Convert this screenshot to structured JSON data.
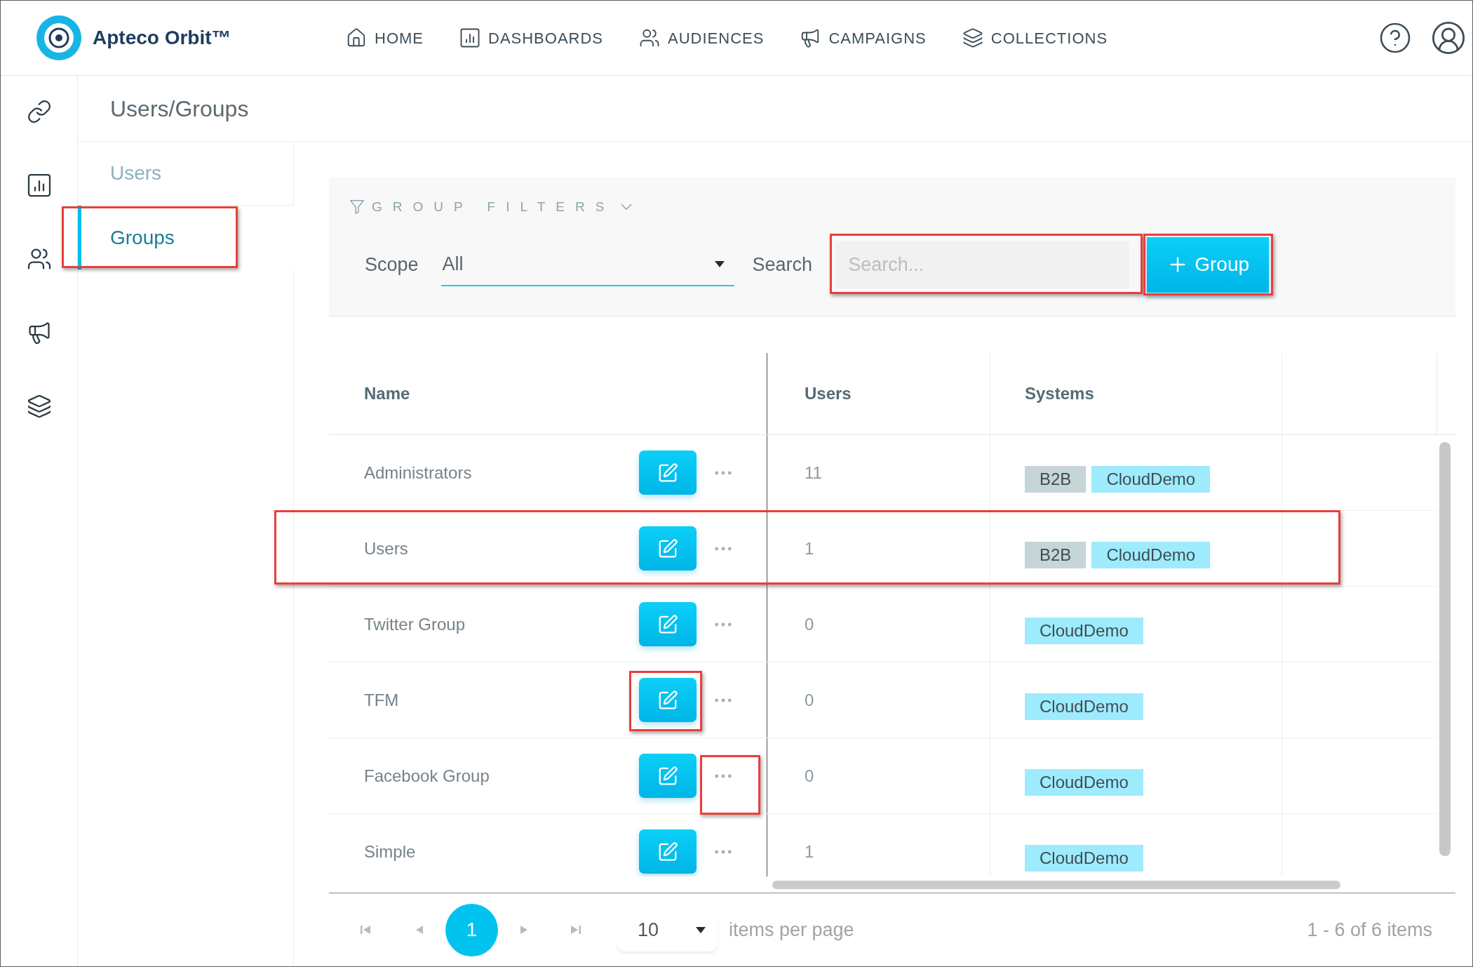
{
  "header": {
    "brand": "Apteco Orbit™",
    "nav": [
      {
        "label": "HOME"
      },
      {
        "label": "DASHBOARDS"
      },
      {
        "label": "AUDIENCES"
      },
      {
        "label": "CAMPAIGNS"
      },
      {
        "label": "COLLECTIONS"
      }
    ]
  },
  "page_title": "Users/Groups",
  "submenu": {
    "items": [
      {
        "label": "Users",
        "selected": false,
        "highlighted": false
      },
      {
        "label": "Groups",
        "selected": true,
        "highlighted": true
      }
    ]
  },
  "filters": {
    "title": "GROUP FILTERS",
    "scope": {
      "label": "Scope",
      "value": "All"
    },
    "search": {
      "label": "Search",
      "placeholder": "Search...",
      "highlighted": true
    },
    "add_button": {
      "label": "Group",
      "highlighted": true
    }
  },
  "table": {
    "columns": [
      "Name",
      "Users",
      "Systems"
    ],
    "rows": [
      {
        "name": "Administrators",
        "users": "11",
        "systems": [
          {
            "label": "B2B",
            "color": "#c5d5d8"
          },
          {
            "label": "CloudDemo",
            "color": "#9debfd"
          }
        ],
        "highlighted": false,
        "edit_highlighted": false,
        "more_highlighted": false
      },
      {
        "name": "Users",
        "users": "1",
        "systems": [
          {
            "label": "B2B",
            "color": "#c5d5d8"
          },
          {
            "label": "CloudDemo",
            "color": "#9debfd"
          }
        ],
        "highlighted": true,
        "edit_highlighted": false,
        "more_highlighted": false
      },
      {
        "name": "Twitter Group",
        "users": "0",
        "systems": [
          {
            "label": "CloudDemo",
            "color": "#9debfd"
          }
        ],
        "highlighted": false,
        "edit_highlighted": false,
        "more_highlighted": false
      },
      {
        "name": "TFM",
        "users": "0",
        "systems": [
          {
            "label": "CloudDemo",
            "color": "#9debfd"
          }
        ],
        "highlighted": false,
        "edit_highlighted": true,
        "more_highlighted": false
      },
      {
        "name": "Facebook Group",
        "users": "0",
        "systems": [
          {
            "label": "CloudDemo",
            "color": "#9debfd"
          }
        ],
        "highlighted": false,
        "edit_highlighted": false,
        "more_highlighted": true
      },
      {
        "name": "Simple",
        "users": "1",
        "systems": [
          {
            "label": "CloudDemo",
            "color": "#9debfd"
          }
        ],
        "highlighted": false,
        "edit_highlighted": false,
        "more_highlighted": false
      }
    ]
  },
  "pagination": {
    "nav": [
      {
        "kind": "first",
        "disabled": true
      },
      {
        "kind": "previous",
        "disabled": true
      },
      {
        "kind": "next",
        "disabled": true
      },
      {
        "kind": "last",
        "disabled": true
      }
    ],
    "pages": [
      {
        "label": "1",
        "selected": true
      }
    ],
    "page_size": "10",
    "page_size_label": "items per page",
    "summary": "1 - 6 of 6 items"
  }
}
